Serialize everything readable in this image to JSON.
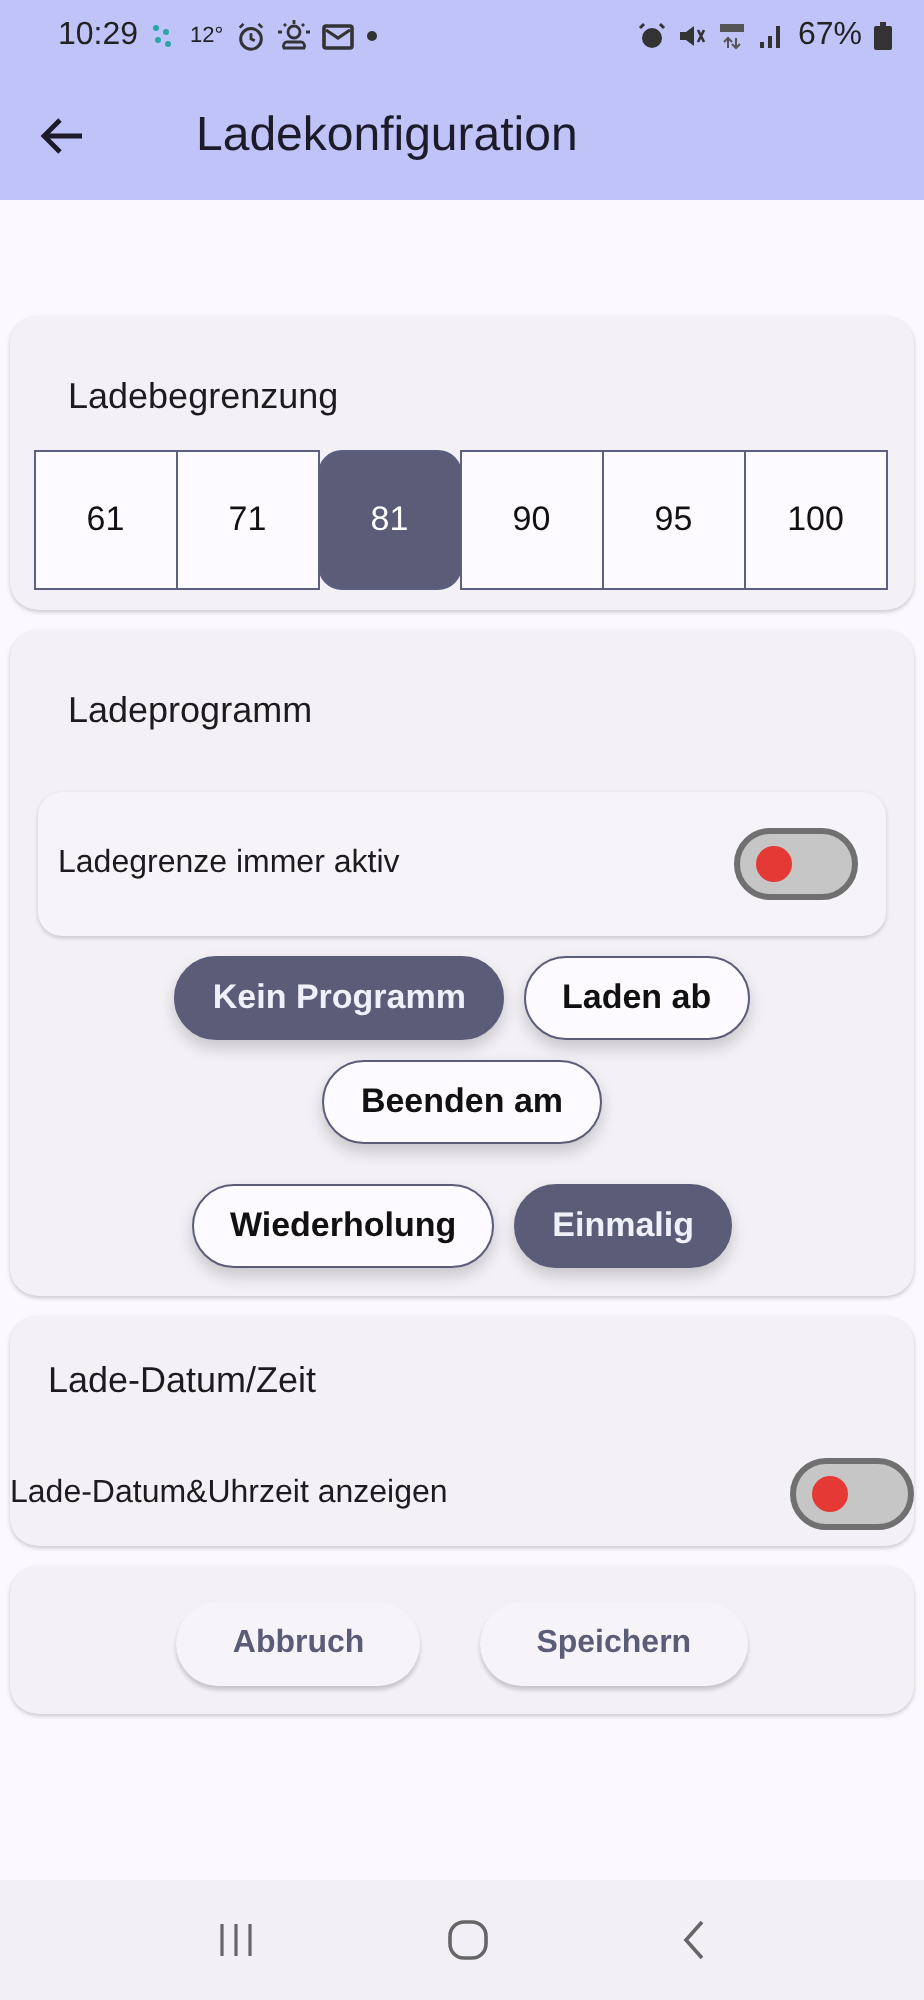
{
  "status_bar": {
    "time": "10:29",
    "temperature": "12°",
    "battery": "67%"
  },
  "app_bar": {
    "title": "Ladekonfiguration"
  },
  "charge_limit": {
    "title": "Ladebegrenzung",
    "options": [
      {
        "label": "61",
        "selected": false
      },
      {
        "label": "71",
        "selected": false
      },
      {
        "label": "81",
        "selected": true
      },
      {
        "label": "90",
        "selected": false
      },
      {
        "label": "95",
        "selected": false
      },
      {
        "label": "100",
        "selected": false
      }
    ]
  },
  "program": {
    "title": "Ladeprogramm",
    "toggle": {
      "label": "Ladegrenze immer aktiv",
      "on": false
    },
    "chip_rows": [
      [
        {
          "label": "Kein Programm",
          "selected": true
        },
        {
          "label": "Laden ab",
          "selected": false
        }
      ],
      [
        {
          "label": "Beenden am",
          "selected": false
        }
      ],
      [
        {
          "label": "Wiederholung",
          "selected": false
        },
        {
          "label": "Einmalig",
          "selected": true
        }
      ]
    ]
  },
  "date_time": {
    "title": "Lade-Datum/Zeit",
    "toggle": {
      "label": "Lade-Datum&Uhrzeit anzeigen",
      "on": false
    }
  },
  "actions": [
    "Abbruch",
    "Speichern"
  ]
}
